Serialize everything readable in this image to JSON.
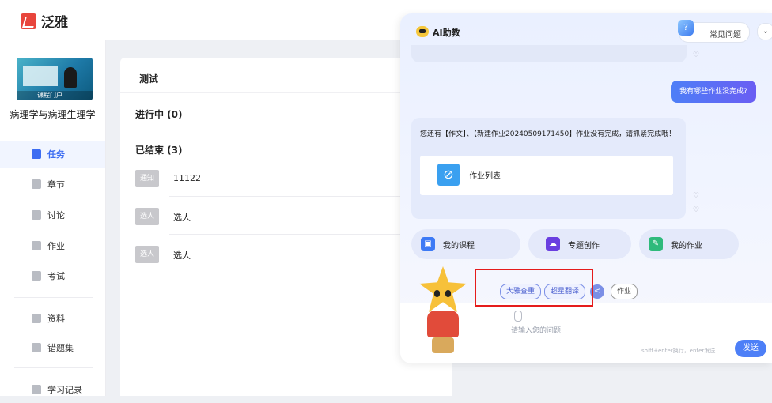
{
  "brand": {
    "name": "泛雅",
    "accent": "#e8453c"
  },
  "sidebar": {
    "course_thumb_tag": "课程门户",
    "course_name": "病理学与病理生理学",
    "items": [
      {
        "label": "任务",
        "icon": "grid-icon",
        "active": true
      },
      {
        "label": "章节",
        "icon": "chapter-icon"
      },
      {
        "label": "讨论",
        "icon": "chat-bubble-icon"
      },
      {
        "label": "作业",
        "icon": "edit-doc-icon"
      },
      {
        "label": "考试",
        "icon": "exam-icon"
      },
      {
        "label": "资料",
        "icon": "folder-icon"
      },
      {
        "label": "错题集",
        "icon": "mistakes-icon"
      },
      {
        "label": "学习记录",
        "icon": "record-icon"
      }
    ]
  },
  "main": {
    "title": "测试",
    "sections": [
      {
        "label": "进行中 (0)"
      },
      {
        "label": "已结束 (3)"
      }
    ],
    "rows": [
      {
        "badge": "通知",
        "text": "11122"
      },
      {
        "badge": "选人",
        "text": "选人"
      },
      {
        "badge": "选人",
        "text": "选人"
      }
    ]
  },
  "assistant": {
    "title": "AI助教",
    "faq_label": "常见问题",
    "faq_icon_glyph": "?",
    "chevron": "⌄",
    "user_message": "我有哪些作业没完成?",
    "bot_message": "您还有【作文】、【新建作业20240509171450】作业没有完成，请抓紧完成哦！",
    "bot_card_label": "作业列表",
    "quick_actions": [
      {
        "label": "我的课程",
        "icon": "course-icon",
        "color": "#3d7af5"
      },
      {
        "label": "专题创作",
        "icon": "cloud-icon",
        "color": "#6a3fe0"
      },
      {
        "label": "我的作业",
        "icon": "homework-icon",
        "color": "#2fba7b"
      }
    ],
    "chips": [
      "大雅查重",
      "超星翻译"
    ],
    "chip_arrow": "<",
    "chip_extra": "作业",
    "input_placeholder": "请输入您的问题",
    "hint": "shift+enter换行，enter发送",
    "send_label": "发送"
  }
}
